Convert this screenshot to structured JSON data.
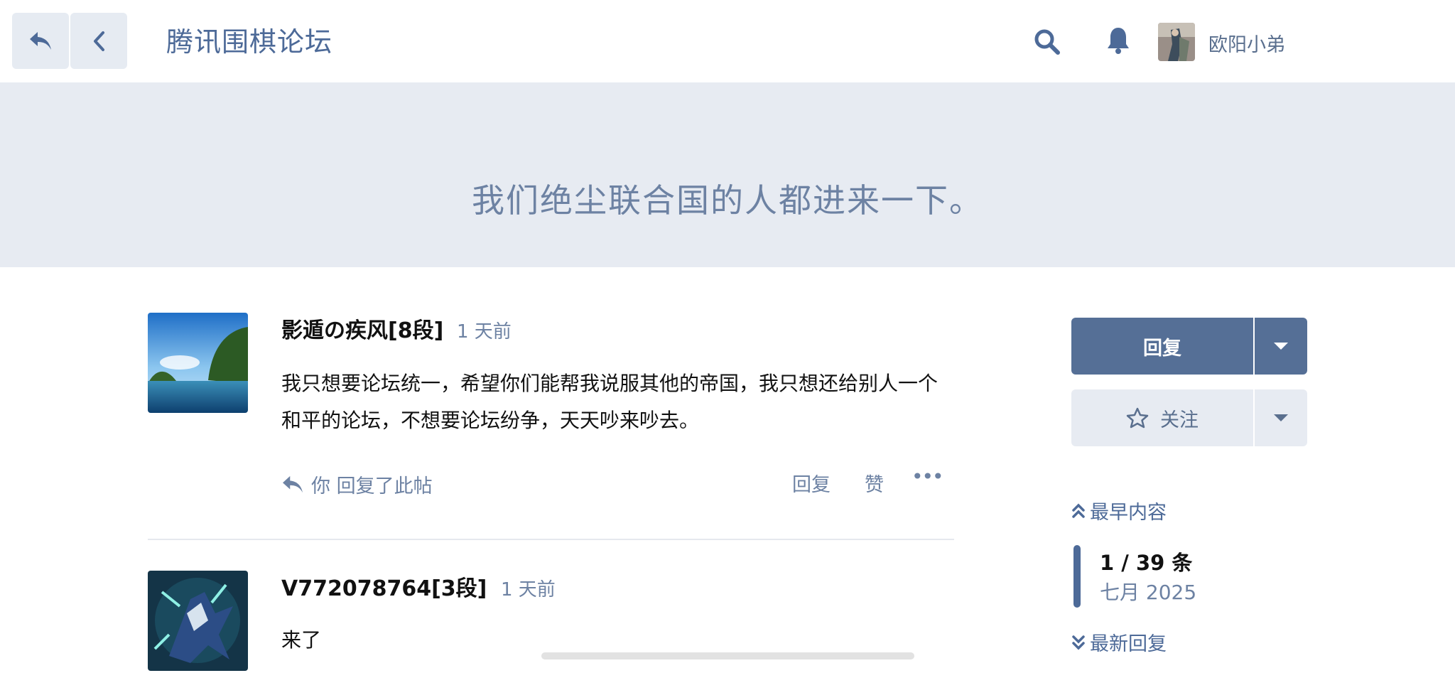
{
  "header": {
    "site_title": "腾讯围棋论坛",
    "username": "欧阳小弟",
    "icons": {
      "back": "reply-back-icon",
      "prev": "chevron-left-icon",
      "search": "search-icon",
      "bell": "bell-icon"
    }
  },
  "topic": {
    "title": "我们绝尘联合国的人都进来一下。"
  },
  "posts": [
    {
      "author": "影遁の疾风[8段]",
      "time": "1 天前",
      "body": "我只想要论坛统一，希望你们能帮我说服其他的帝国，我只想还给别人一个和平的论坛，不想要论坛纷争，天天吵来吵去。",
      "reply_info": "你 回复了此帖",
      "actions": {
        "reply": "回复",
        "like": "赞",
        "more": "•••"
      }
    },
    {
      "author": "V772078764[3段]",
      "time": "1 天前",
      "body": "来了"
    }
  ],
  "sidebar": {
    "reply_label": "回复",
    "follow_label": "关注",
    "earliest_label": "最早内容",
    "counter": "1 / 39 条",
    "month": "七月 2025",
    "latest_label": "最新回复"
  },
  "colors": {
    "accent": "#556f96",
    "banner_bg": "#e7ebf2",
    "muted_text": "#6d82a3"
  }
}
